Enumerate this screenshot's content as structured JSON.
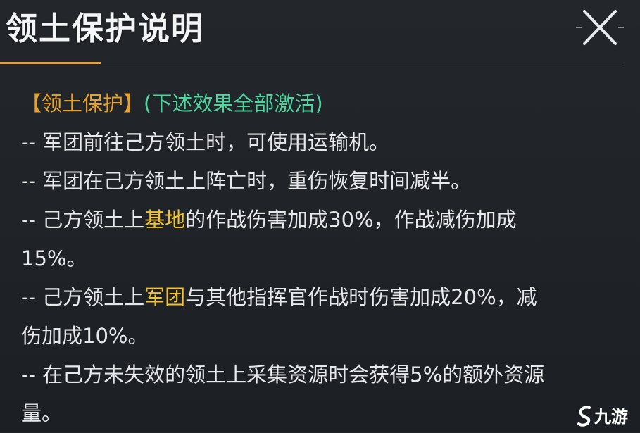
{
  "panel": {
    "title": "领土保护说明"
  },
  "content": {
    "header_bracket": "【领土保护】",
    "header_note": "(下述效果全部激活)",
    "line1": "-- 军团前往己方领土时，可使用运输机。",
    "line2": "-- 军团在己方领土上阵亡时，重伤恢复时间减半。",
    "line3_pre": "-- 己方领土上",
    "line3_hl": "基地",
    "line3_post": "的作战伤害加成30%，作战减伤加成",
    "line3_cont": "15%。",
    "line4_pre": "-- 己方领土上",
    "line4_hl": "军团",
    "line4_post": "与其他指挥官作战时伤害加成20%，减",
    "line4_cont": "伤加成10%。",
    "line5": "-- 在己方未失效的领土上采集资源时会获得5%的额外资源",
    "line5_cont": "量。"
  },
  "watermark": {
    "text": "九游"
  },
  "colors": {
    "accent_orange": "#e8a12a",
    "green": "#4ed59e",
    "highlight_yellow": "#f2c230",
    "text": "#e6e8ea"
  },
  "icons": {
    "close": "close-x-icon",
    "watermark": "jiuyou-logo-icon"
  }
}
